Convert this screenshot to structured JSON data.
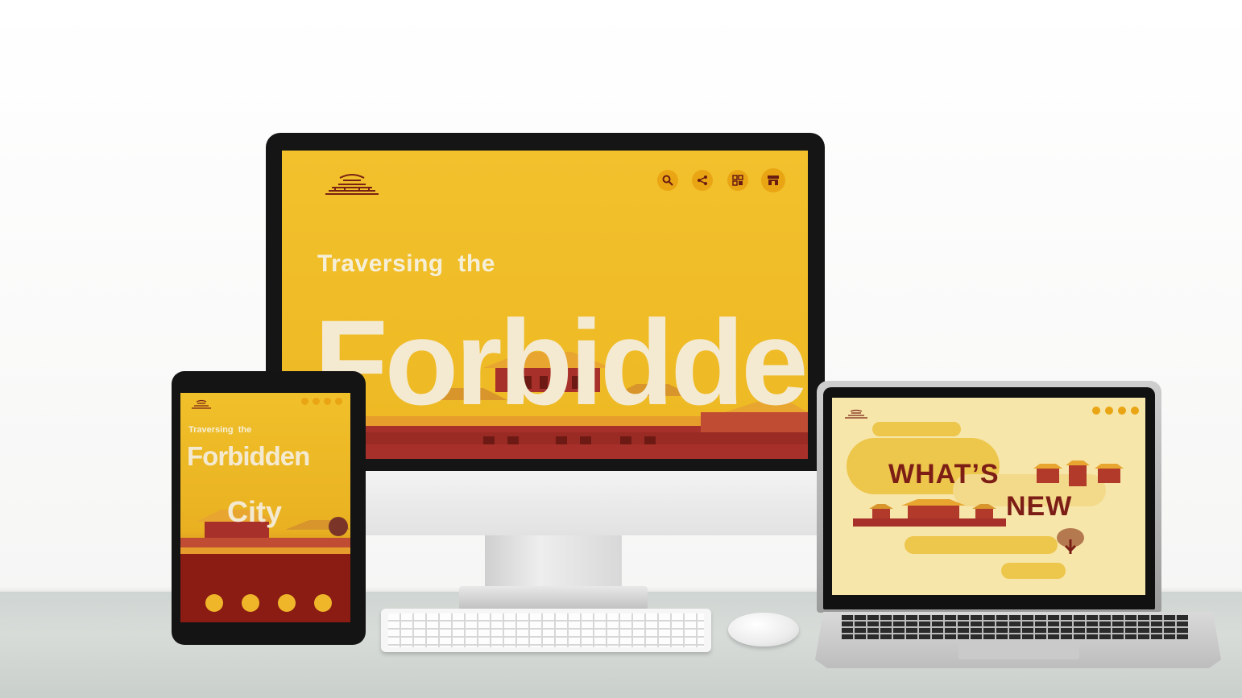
{
  "desktop": {
    "brand": "palace-logo",
    "nav_icons": [
      "search-icon",
      "share-icon",
      "grid-icon",
      "shop-icon"
    ],
    "headline_small": "Traversing  the",
    "headline_big": "Forbidden"
  },
  "tablet": {
    "headline_small": "Traversing  the",
    "headline_big_line1": "Forbidden",
    "headline_big_line2": "City",
    "bottom_icons": [
      "gate-icon",
      "gate-icon",
      "gate-icon",
      "gate-icon"
    ]
  },
  "laptop": {
    "headline_line1": "WHAT’S",
    "headline_line2": "NEW"
  },
  "colors": {
    "primary_yellow": "#f0c02a",
    "deep_red": "#8b1c14",
    "cream": "#f4ead2",
    "accent_orange": "#e9a514"
  }
}
